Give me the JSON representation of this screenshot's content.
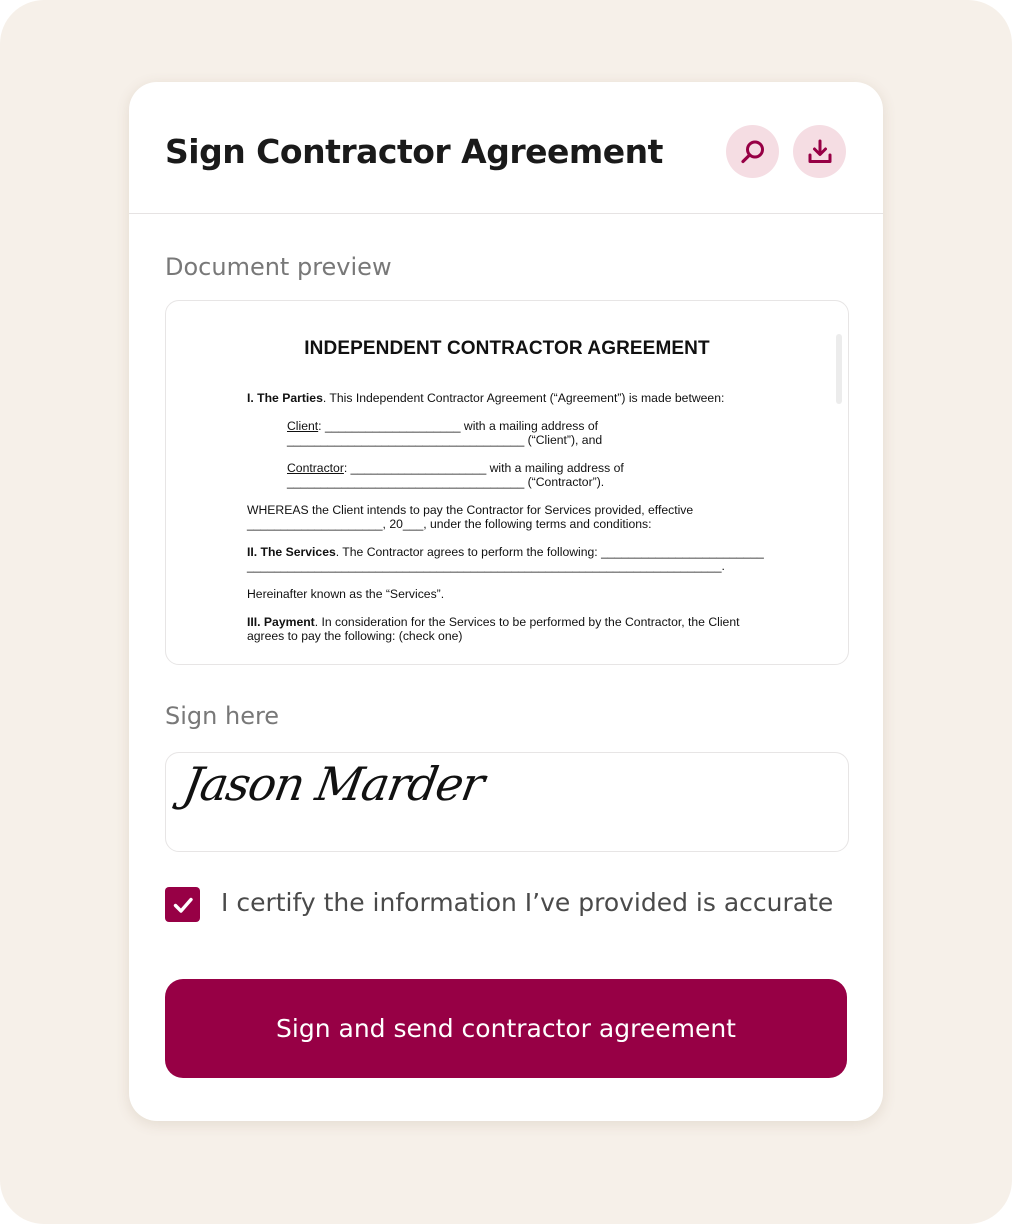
{
  "colors": {
    "accent": "#970045",
    "icon_bg": "#f5dde3",
    "background": "#f6f0e9"
  },
  "header": {
    "title": "Sign Contractor Agreement",
    "search_icon": "search-icon",
    "download_icon": "download-icon"
  },
  "preview": {
    "label": "Document preview",
    "doc": {
      "title": "INDEPENDENT CONTRACTOR AGREEMENT",
      "parties_heading": "I. The Parties",
      "parties_text": ". This Independent Contractor Agreement (“Agreement”) is made between:",
      "client_label": "Client",
      "client_line1": ": ____________________ with a mailing address of",
      "client_line2": "___________________________________ (“Client”), and",
      "contractor_label": "Contractor",
      "contractor_line1": ": ____________________ with a mailing address of",
      "contractor_line2": "___________________________________ (“Contractor”).",
      "whereas_line1": "WHEREAS the Client intends to pay the Contractor for Services provided, effective",
      "whereas_line2": "____________________, 20___, under the following terms and conditions:",
      "services_heading": "II. The Services",
      "services_text": ". The Contractor agrees to perform the following: ________________________",
      "services_line2": "______________________________________________________________________.",
      "hereinafter": "Hereinafter known as the “Services”.",
      "payment_heading": "III. Payment",
      "payment_text": ". In consideration for the Services to be performed by the Contractor, the Client",
      "payment_line2": "agrees to pay the following: (check one)"
    }
  },
  "signature": {
    "label": "Sign here",
    "value": "Jason Marder"
  },
  "certify": {
    "checked": true,
    "label": "I certify the information I’ve provided is accurate"
  },
  "submit": {
    "label": "Sign and send contractor agreement"
  }
}
